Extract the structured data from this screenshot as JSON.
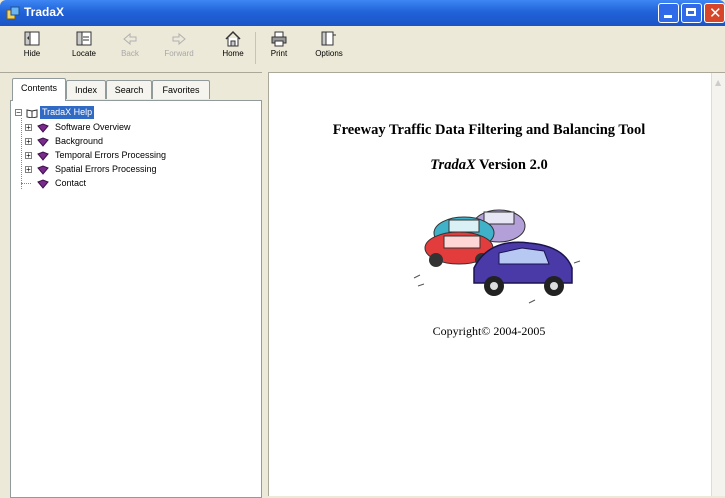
{
  "window": {
    "title": "TradaX"
  },
  "toolbar": {
    "buttons": [
      {
        "label": "Hide",
        "icon": "hide-icon",
        "enabled": true
      },
      {
        "label": "Locate",
        "icon": "locate-icon",
        "enabled": true
      },
      {
        "label": "Back",
        "icon": "back-arrow-icon",
        "enabled": false
      },
      {
        "label": "Forward",
        "icon": "forward-arrow-icon",
        "enabled": false
      },
      {
        "label": "Home",
        "icon": "home-icon",
        "enabled": true
      },
      {
        "label": "Print",
        "icon": "printer-icon",
        "enabled": true
      },
      {
        "label": "Options",
        "icon": "options-icon",
        "enabled": true
      }
    ]
  },
  "tabs": [
    {
      "label": "Contents",
      "active": true
    },
    {
      "label": "Index",
      "active": false
    },
    {
      "label": "Search",
      "active": false
    },
    {
      "label": "Favorites",
      "active": false
    }
  ],
  "tree": {
    "root": {
      "label": "TradaX Help",
      "expanded": true,
      "selected": true
    },
    "children": [
      {
        "label": "Software Overview",
        "expandable": true
      },
      {
        "label": "Background",
        "expandable": true
      },
      {
        "label": "Temporal Errors Processing",
        "expandable": true
      },
      {
        "label": "Spatial Errors Processing",
        "expandable": true
      },
      {
        "label": "Contact",
        "expandable": false
      }
    ]
  },
  "content": {
    "title": "Freeway Traffic Data Filtering and Balancing Tool",
    "product_name": "TradaX",
    "version_text": " Version 2.0",
    "copyright": "Copyright© 2004-2005"
  },
  "colors": {
    "titlebar": "#2163d9",
    "selection": "#316ac5",
    "book": "#7a2a8c"
  }
}
